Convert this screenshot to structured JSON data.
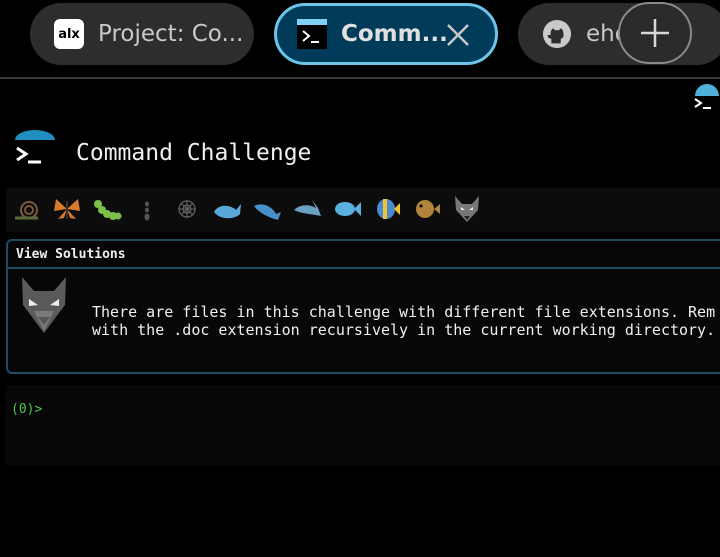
{
  "tabs": [
    {
      "title": "Project: Co...",
      "icon": "alx-icon",
      "icon_text": "alx",
      "active": false
    },
    {
      "title": "Comm...",
      "icon": "terminal-icon",
      "active": true
    },
    {
      "title": "eho",
      "icon": "github-icon",
      "active": false
    }
  ],
  "page": {
    "title": "Command Challenge"
  },
  "levels": [
    "snail-icon",
    "butterfly-icon",
    "caterpillar-icon",
    "ant-icon",
    "spider-web-icon",
    "whale-icon",
    "whale-blue-icon",
    "dolphin-icon",
    "fish-icon",
    "tropical-fish-icon",
    "blowfish-icon",
    "wolf-icon"
  ],
  "panel": {
    "header": "View Solutions",
    "line1": "There are files in this challenge with different file extensions. Rem",
    "line2": "with the .doc extension recursively in the current working directory."
  },
  "terminal": {
    "prompt": "(0)>"
  },
  "colors": {
    "accent": "#6fc3ea",
    "active_tab_bg": "#003c5a",
    "prompt": "#4cc94c",
    "panel_border": "#1f4a63"
  }
}
